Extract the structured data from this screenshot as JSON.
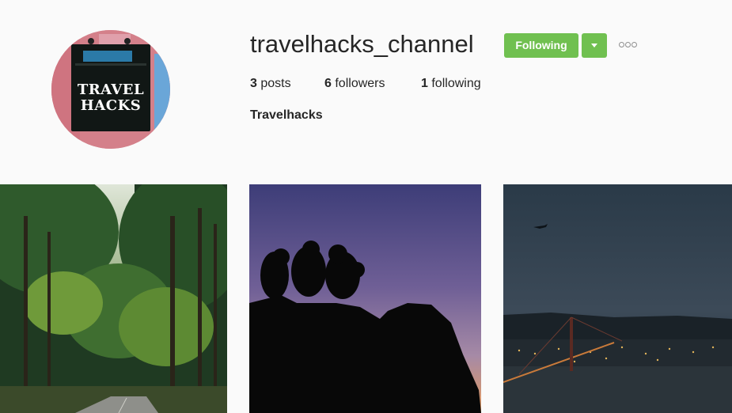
{
  "profile": {
    "username": "travelhacks_channel",
    "full_name": "Travelhacks",
    "avatar_text_line1": "TRAVEL",
    "avatar_text_line2": "HACKS"
  },
  "actions": {
    "following_label": "Following",
    "accent_color": "#70c050"
  },
  "stats": {
    "posts_count": "3",
    "posts_label": "posts",
    "followers_count": "6",
    "followers_label": "followers",
    "following_count": "1",
    "following_label": "following"
  },
  "posts": [
    {
      "subject": "forest-road"
    },
    {
      "subject": "silhouettes-at-sunset"
    },
    {
      "subject": "bridge-city-lights-at-dusk"
    }
  ],
  "icons": {
    "dropdown": "chevron-down-icon",
    "more": "more-options-icon"
  }
}
